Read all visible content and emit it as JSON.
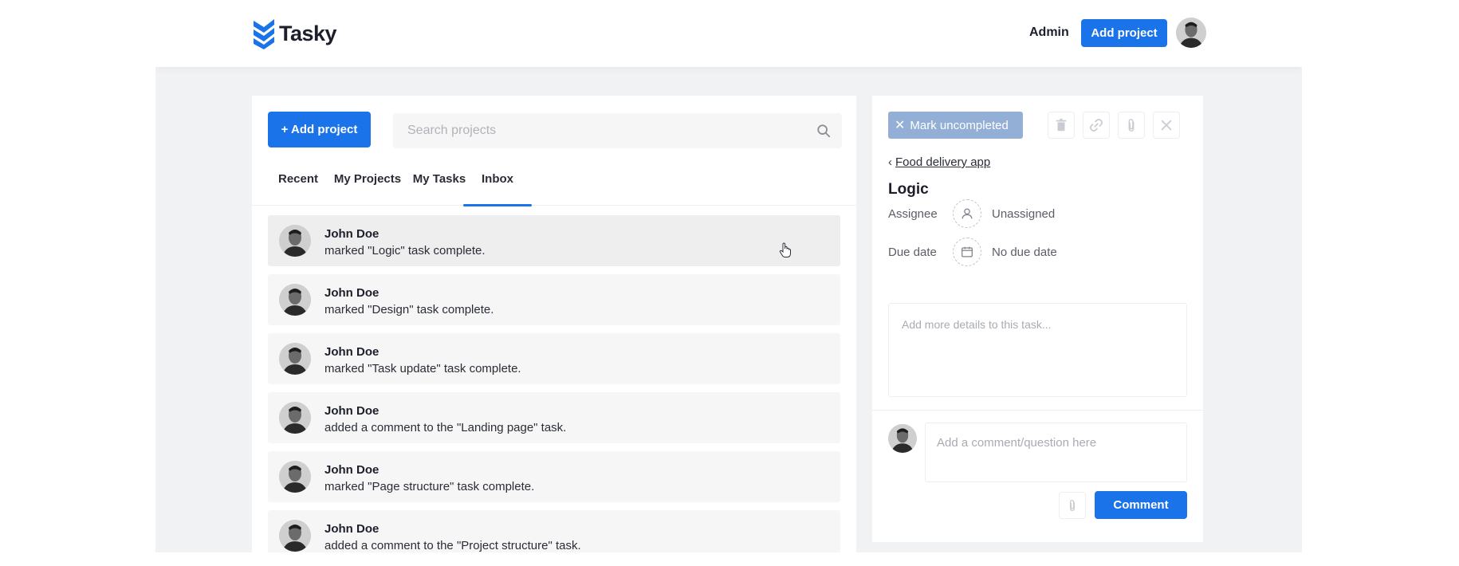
{
  "header": {
    "logo_text": "Tasky",
    "admin_label": "Admin",
    "add_project_label": "Add project"
  },
  "projects_panel": {
    "add_project_label": "+ Add project",
    "search_placeholder": "Search projects",
    "tabs": [
      {
        "label": "Recent",
        "active": false
      },
      {
        "label": "My Projects",
        "active": false
      },
      {
        "label": "My Tasks",
        "active": false
      },
      {
        "label": "Inbox",
        "active": true
      }
    ],
    "feed": [
      {
        "name": "John Doe",
        "text": "marked \"Logic\" task complete."
      },
      {
        "name": "John Doe",
        "text": "marked \"Design\" task complete."
      },
      {
        "name": "John Doe",
        "text": "marked \"Task update\" task complete."
      },
      {
        "name": "John Doe",
        "text": "added a comment to the \"Landing page\" task."
      },
      {
        "name": "John Doe",
        "text": "marked \"Page structure\" task complete."
      },
      {
        "name": "John Doe",
        "text": "added a comment to the \"Project structure\" task."
      }
    ]
  },
  "task_panel": {
    "mark_label": "Mark uncompleted",
    "project_link": "Food delivery app",
    "task_title": "Logic",
    "assignee_label": "Assignee",
    "assignee_value": "Unassigned",
    "due_label": "Due date",
    "due_value": "No due date",
    "details_placeholder": "Add more details to this task...",
    "comment_placeholder": "Add a comment/question here",
    "comment_button": "Comment"
  },
  "colors": {
    "accent": "#1a73e8",
    "mark_button": "#93afd6",
    "background": "#f1f2f4"
  }
}
